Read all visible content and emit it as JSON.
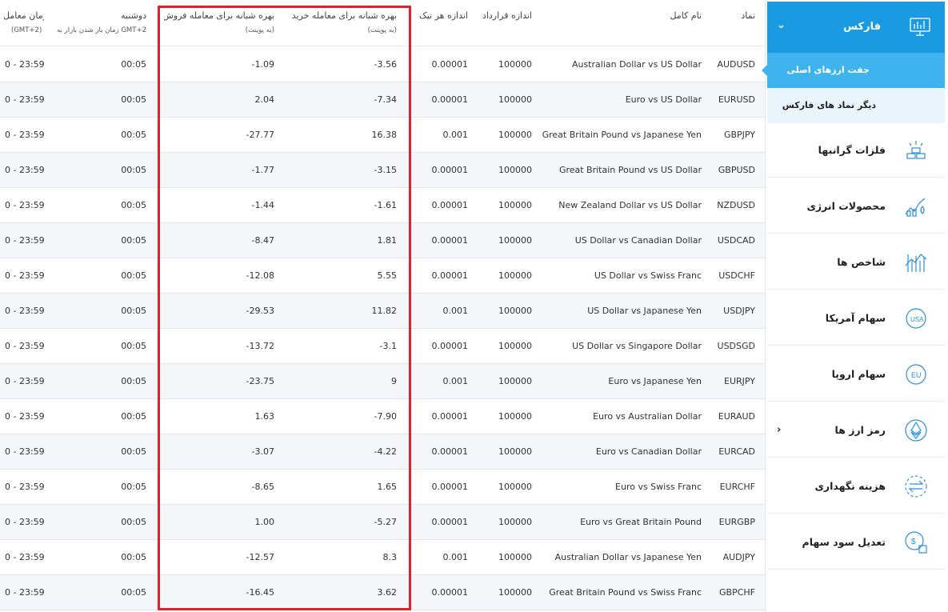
{
  "table": {
    "headers": {
      "symbol": "نماد",
      "fullname": "نام کامل",
      "contract": "اندازه قرارداد",
      "tick": "اندازه هر تیک",
      "buy": "بهره شبانه برای معامله خرید",
      "buy_sub": "(به پوینت)",
      "sell": "بهره شبانه برای معامله فروش",
      "sell_sub": "(به پوینت)",
      "monday": "دوشنبه",
      "monday_sub": "زمان باز شدن بازار به GMT+2",
      "time": "زمان معامل",
      "time_sub": "(GMT+2)"
    },
    "rows": [
      {
        "symbol": "AUDUSD",
        "name": "Australian Dollar vs US Dollar",
        "contract": "100000",
        "tick": "0.00001",
        "buy": "-3.56",
        "sell": "-1.09",
        "monday": "00:05",
        "time": "0 - 23:59"
      },
      {
        "symbol": "EURUSD",
        "name": "Euro vs US Dollar",
        "contract": "100000",
        "tick": "0.00001",
        "buy": "-7.34",
        "sell": "2.04",
        "monday": "00:05",
        "time": "0 - 23:59"
      },
      {
        "symbol": "GBPJPY",
        "name": "Great Britain Pound vs Japanese Yen",
        "contract": "100000",
        "tick": "0.001",
        "buy": "16.38",
        "sell": "-27.77",
        "monday": "00:05",
        "time": "0 - 23:59"
      },
      {
        "symbol": "GBPUSD",
        "name": "Great Britain Pound vs US Dollar",
        "contract": "100000",
        "tick": "0.00001",
        "buy": "-3.15",
        "sell": "-1.77",
        "monday": "00:05",
        "time": "0 - 23:59"
      },
      {
        "symbol": "NZDUSD",
        "name": "New Zealand Dollar vs US Dollar",
        "contract": "100000",
        "tick": "0.00001",
        "buy": "-1.61",
        "sell": "-1.44",
        "monday": "00:05",
        "time": "0 - 23:59"
      },
      {
        "symbol": "USDCAD",
        "name": "US Dollar vs Canadian Dollar",
        "contract": "100000",
        "tick": "0.00001",
        "buy": "1.81",
        "sell": "-8.47",
        "monday": "00:05",
        "time": "0 - 23:59"
      },
      {
        "symbol": "USDCHF",
        "name": "US Dollar vs Swiss Franc",
        "contract": "100000",
        "tick": "0.00001",
        "buy": "5.55",
        "sell": "-12.08",
        "monday": "00:05",
        "time": "0 - 23:59"
      },
      {
        "symbol": "USDJPY",
        "name": "US Dollar vs Japanese Yen",
        "contract": "100000",
        "tick": "0.001",
        "buy": "11.82",
        "sell": "-29.53",
        "monday": "00:05",
        "time": "0 - 23:59"
      },
      {
        "symbol": "USDSGD",
        "name": "US Dollar vs Singapore Dollar",
        "contract": "100000",
        "tick": "0.00001",
        "buy": "-3.1",
        "sell": "-13.72",
        "monday": "00:05",
        "time": "0 - 23:59"
      },
      {
        "symbol": "EURJPY",
        "name": "Euro vs Japanese Yen",
        "contract": "100000",
        "tick": "0.001",
        "buy": "9",
        "sell": "-23.75",
        "monday": "00:05",
        "time": "0 - 23:59"
      },
      {
        "symbol": "EURAUD",
        "name": "Euro vs Australian Dollar",
        "contract": "100000",
        "tick": "0.00001",
        "buy": "-7.90",
        "sell": "1.63",
        "monday": "00:05",
        "time": "0 - 23:59"
      },
      {
        "symbol": "EURCAD",
        "name": "Euro vs Canadian Dollar",
        "contract": "100000",
        "tick": "0.00001",
        "buy": "-4.22",
        "sell": "-3.07",
        "monday": "00:05",
        "time": "0 - 23:59"
      },
      {
        "symbol": "EURCHF",
        "name": "Euro vs Swiss Franc",
        "contract": "100000",
        "tick": "0.00001",
        "buy": "1.65",
        "sell": "-8.65",
        "monday": "00:05",
        "time": "0 - 23:59"
      },
      {
        "symbol": "EURGBP",
        "name": "Euro vs Great Britain Pound",
        "contract": "100000",
        "tick": "0.00001",
        "buy": "-5.27",
        "sell": "1.00",
        "monday": "00:05",
        "time": "0 - 23:59"
      },
      {
        "symbol": "AUDJPY",
        "name": "Australian Dollar vs Japanese Yen",
        "contract": "100000",
        "tick": "0.001",
        "buy": "8.3",
        "sell": "-12.57",
        "monday": "00:05",
        "time": "0 - 23:59"
      },
      {
        "symbol": "GBPCHF",
        "name": "Great Britain Pound vs Swiss Franc",
        "contract": "100000",
        "tick": "0.00001",
        "buy": "3.62",
        "sell": "-16.45",
        "monday": "00:05",
        "time": "0 - 23:59"
      }
    ]
  },
  "sidebar": {
    "forex": {
      "label": "فارکس",
      "icon": "forex-chart-icon"
    },
    "forex_sub": [
      {
        "label": "جفت ارزهای اصلی",
        "active": true
      },
      {
        "label": "دیگر نماد های فارکس",
        "active": false
      }
    ],
    "categories": [
      {
        "label": "فلزات گرانبها",
        "icon": "gold-bars-icon",
        "has_arrow": false
      },
      {
        "label": "محصولات انرژی",
        "icon": "oil-pump-icon",
        "has_arrow": false
      },
      {
        "label": "شاخص ها",
        "icon": "index-chart-icon",
        "has_arrow": false
      },
      {
        "label": "سهام آمریکا",
        "icon": "usa-stocks-icon",
        "has_arrow": false
      },
      {
        "label": "سهام اروپا",
        "icon": "eu-stocks-icon",
        "has_arrow": false
      },
      {
        "label": "رمز ارز ها",
        "icon": "ethereum-icon",
        "has_arrow": true
      },
      {
        "label": "هزینه نگهداری",
        "icon": "swap-arrows-icon",
        "has_arrow": false
      },
      {
        "label": "تعدیل سود سهام",
        "icon": "dividend-icon",
        "has_arrow": false
      }
    ]
  },
  "colors": {
    "accent": "#1a9ae1",
    "accent_light": "#3eb3ee",
    "sub_bg": "#e9f4fb",
    "highlight": "#e0202a",
    "icon_blue": "#2a8fd8"
  }
}
